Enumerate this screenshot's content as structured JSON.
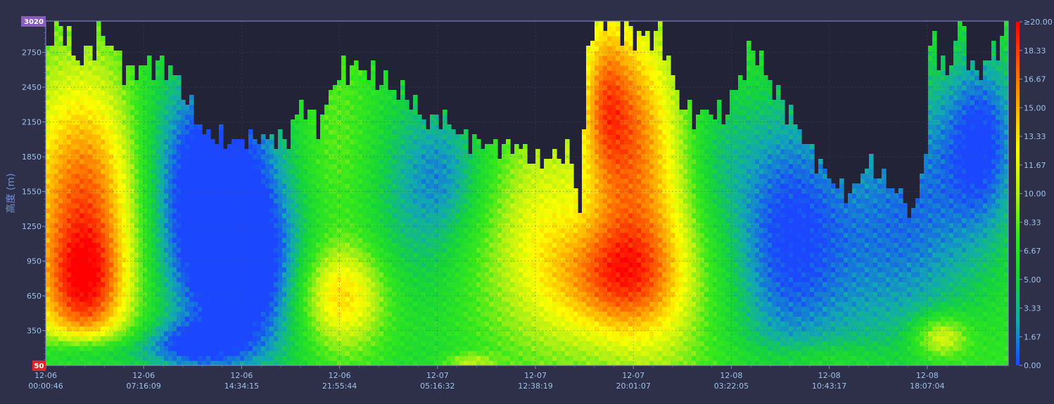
{
  "chart_data": {
    "type": "heatmap",
    "ylabel": "高度 (m)",
    "y_ticks": [
      350,
      650,
      950,
      1250,
      1550,
      1850,
      2150,
      2450,
      2750
    ],
    "ylim": [
      50,
      3020
    ],
    "ylim_labels": {
      "min": "50",
      "max": "3020"
    },
    "x_ticks": [
      {
        "date": "12-06",
        "time": "00:00:46"
      },
      {
        "date": "12-06",
        "time": "07:16:09"
      },
      {
        "date": "12-06",
        "time": "14:34:15"
      },
      {
        "date": "12-06",
        "time": "21:55:44"
      },
      {
        "date": "12-07",
        "time": "05:16:32"
      },
      {
        "date": "12-07",
        "time": "12:38:19"
      },
      {
        "date": "12-07",
        "time": "20:01:07"
      },
      {
        "date": "12-08",
        "time": "03:22:05"
      },
      {
        "date": "12-08",
        "time": "10:43:17"
      },
      {
        "date": "12-08",
        "time": "18:07:04"
      }
    ],
    "colorbar": {
      "range": [
        0,
        20
      ],
      "labels": [
        "0.00",
        "1.67",
        "3.33",
        "5.00",
        "6.67",
        "8.33",
        "10.00",
        "11.67",
        "13.33",
        "15.00",
        "16.67",
        "18.33",
        "≥20.00"
      ],
      "colors": [
        "#1a47ff",
        "#12a8b4",
        "#15d43a",
        "#34e81c",
        "#b0f014",
        "#ffff00",
        "#ffb000",
        "#ff5a00",
        "#ff0000"
      ]
    },
    "data_top_height": [
      {
        "t": 0.0,
        "h": 2760
      },
      {
        "t": 0.015,
        "h": 3020
      },
      {
        "t": 0.035,
        "h": 2650
      },
      {
        "t": 0.06,
        "h": 2920
      },
      {
        "t": 0.085,
        "h": 2560
      },
      {
        "t": 0.11,
        "h": 2650
      },
      {
        "t": 0.13,
        "h": 2600
      },
      {
        "t": 0.15,
        "h": 2300
      },
      {
        "t": 0.165,
        "h": 2050
      },
      {
        "t": 0.19,
        "h": 1980
      },
      {
        "t": 0.215,
        "h": 2000
      },
      {
        "t": 0.23,
        "h": 2020
      },
      {
        "t": 0.25,
        "h": 1980
      },
      {
        "t": 0.265,
        "h": 2300
      },
      {
        "t": 0.285,
        "h": 2120
      },
      {
        "t": 0.3,
        "h": 2500
      },
      {
        "t": 0.32,
        "h": 2650
      },
      {
        "t": 0.345,
        "h": 2530
      },
      {
        "t": 0.365,
        "h": 2430
      },
      {
        "t": 0.38,
        "h": 2330
      },
      {
        "t": 0.395,
        "h": 2140
      },
      {
        "t": 0.41,
        "h": 2200
      },
      {
        "t": 0.43,
        "h": 2050
      },
      {
        "t": 0.45,
        "h": 1960
      },
      {
        "t": 0.47,
        "h": 1940
      },
      {
        "t": 0.49,
        "h": 1960
      },
      {
        "t": 0.51,
        "h": 1800
      },
      {
        "t": 0.53,
        "h": 1870
      },
      {
        "t": 0.545,
        "h": 1880
      },
      {
        "t": 0.555,
        "h": 1350
      },
      {
        "t": 0.565,
        "h": 3020
      },
      {
        "t": 0.59,
        "h": 3020
      },
      {
        "t": 0.615,
        "h": 2860
      },
      {
        "t": 0.64,
        "h": 2920
      },
      {
        "t": 0.655,
        "h": 2400
      },
      {
        "t": 0.67,
        "h": 2200
      },
      {
        "t": 0.69,
        "h": 2250
      },
      {
        "t": 0.705,
        "h": 2200
      },
      {
        "t": 0.72,
        "h": 2500
      },
      {
        "t": 0.735,
        "h": 2800
      },
      {
        "t": 0.755,
        "h": 2450
      },
      {
        "t": 0.775,
        "h": 2200
      },
      {
        "t": 0.795,
        "h": 1900
      },
      {
        "t": 0.815,
        "h": 1650
      },
      {
        "t": 0.835,
        "h": 1520
      },
      {
        "t": 0.855,
        "h": 1800
      },
      {
        "t": 0.875,
        "h": 1620
      },
      {
        "t": 0.89,
        "h": 1530
      },
      {
        "t": 0.9,
        "h": 1300
      },
      {
        "t": 0.915,
        "h": 1900
      },
      {
        "t": 0.92,
        "h": 3020
      },
      {
        "t": 0.935,
        "h": 2500
      },
      {
        "t": 0.95,
        "h": 3020
      },
      {
        "t": 0.965,
        "h": 2520
      },
      {
        "t": 0.98,
        "h": 2700
      },
      {
        "t": 1.0,
        "h": 2950
      }
    ],
    "intensity_blobs": [
      {
        "t": 0.045,
        "h": 1400,
        "st": 0.045,
        "sh": 800,
        "v": 11
      },
      {
        "t": 0.04,
        "h": 700,
        "st": 0.03,
        "sh": 350,
        "v": 6
      },
      {
        "t": 0.11,
        "h": 1500,
        "st": 0.04,
        "sh": 900,
        "v": -3
      },
      {
        "t": 0.17,
        "h": 1600,
        "st": 0.04,
        "sh": 700,
        "v": -4
      },
      {
        "t": 0.2,
        "h": 1500,
        "st": 0.06,
        "sh": 900,
        "v": -6
      },
      {
        "t": 0.22,
        "h": 700,
        "st": 0.05,
        "sh": 500,
        "v": -5
      },
      {
        "t": 0.3,
        "h": 1800,
        "st": 0.035,
        "sh": 700,
        "v": 3
      },
      {
        "t": 0.305,
        "h": 650,
        "st": 0.035,
        "sh": 320,
        "v": 8
      },
      {
        "t": 0.38,
        "h": 1500,
        "st": 0.05,
        "sh": 900,
        "v": -4
      },
      {
        "t": 0.47,
        "h": 1100,
        "st": 0.04,
        "sh": 600,
        "v": 2
      },
      {
        "t": 0.42,
        "h": 1700,
        "st": 0.03,
        "sh": 400,
        "v": -3
      },
      {
        "t": 0.52,
        "h": 1300,
        "st": 0.03,
        "sh": 700,
        "v": 3
      },
      {
        "t": 0.6,
        "h": 2100,
        "st": 0.03,
        "sh": 700,
        "v": 8
      },
      {
        "t": 0.58,
        "h": 2400,
        "st": 0.015,
        "sh": 500,
        "v": 4
      },
      {
        "t": 0.59,
        "h": 800,
        "st": 0.045,
        "sh": 380,
        "v": 9
      },
      {
        "t": 0.64,
        "h": 1300,
        "st": 0.035,
        "sh": 900,
        "v": 4
      },
      {
        "t": 0.68,
        "h": 1800,
        "st": 0.02,
        "sh": 800,
        "v": -1
      },
      {
        "t": 0.7,
        "h": 1900,
        "st": 0.025,
        "sh": 500,
        "v": -2
      },
      {
        "t": 0.76,
        "h": 1200,
        "st": 0.04,
        "sh": 900,
        "v": -5
      },
      {
        "t": 0.83,
        "h": 1100,
        "st": 0.06,
        "sh": 900,
        "v": -5
      },
      {
        "t": 0.91,
        "h": 1500,
        "st": 0.04,
        "sh": 900,
        "v": -4
      },
      {
        "t": 0.93,
        "h": 300,
        "st": 0.02,
        "sh": 130,
        "v": 6
      },
      {
        "t": 0.975,
        "h": 2000,
        "st": 0.03,
        "sh": 600,
        "v": -7
      },
      {
        "t": 0.975,
        "h": 900,
        "st": 0.04,
        "sh": 500,
        "v": -1
      },
      {
        "t": 0.04,
        "h": 150,
        "st": 0.04,
        "sh": 120,
        "v": -6
      },
      {
        "t": 0.15,
        "h": 220,
        "st": 0.04,
        "sh": 150,
        "v": -5
      },
      {
        "t": 0.43,
        "h": 100,
        "st": 0.04,
        "sh": 110,
        "v": -1
      },
      {
        "t": 0.44,
        "h": 80,
        "st": 0.02,
        "sh": 60,
        "v": 4
      },
      {
        "t": 0.8,
        "h": 100,
        "st": 0.05,
        "sh": 110,
        "v": 2
      }
    ],
    "base_value": 7.5
  }
}
